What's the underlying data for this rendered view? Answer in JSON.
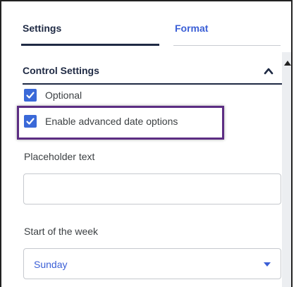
{
  "tabs": {
    "settings": "Settings",
    "format": "Format"
  },
  "section": {
    "title": "Control Settings"
  },
  "checkboxes": [
    {
      "label": "Optional",
      "checked": true
    },
    {
      "label": "Enable advanced date options",
      "checked": true
    }
  ],
  "placeholder_field": {
    "label": "Placeholder text",
    "value": ""
  },
  "week_start": {
    "label": "Start of the week",
    "selected": "Sunday"
  },
  "colors": {
    "accent": "#3a69d8",
    "highlight": "#5c2d83",
    "heading": "#1f2a44"
  }
}
